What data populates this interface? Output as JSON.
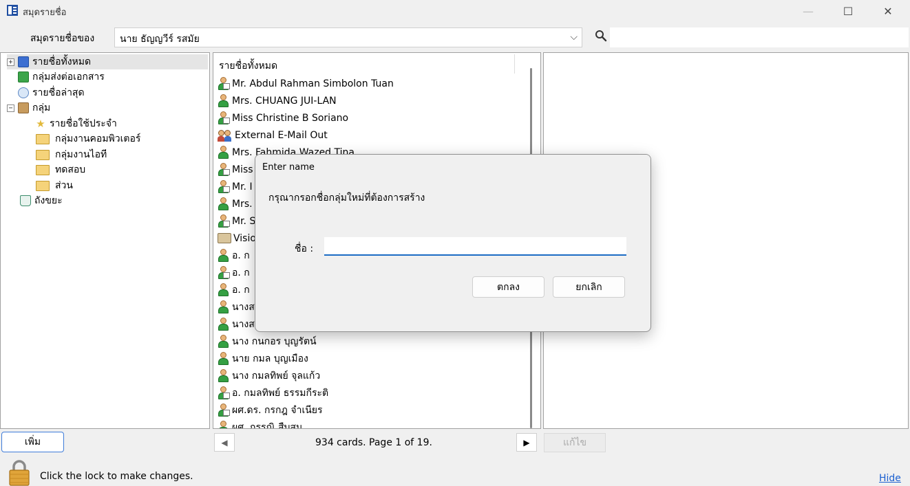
{
  "window": {
    "title": "สมุดรายชื่อ",
    "minimize_glyph": "—",
    "maximize_glyph": "☐",
    "close_glyph": "✕"
  },
  "toolbar": {
    "owner_label": "สมุดรายชื่อของ",
    "owner_value": "นาย ธัญญวีร์ รสมัย",
    "dropdown_glyph": "⌵",
    "search_placeholder": ""
  },
  "tree": [
    {
      "label": "รายชื่อทั้งหมด",
      "icon": "address-book-icon",
      "toggle": "+",
      "selected": true
    },
    {
      "label": "กลุ่มส่งต่อเอกสาร",
      "icon": "forward-group-icon"
    },
    {
      "label": "รายชื่อล่าสุด",
      "icon": "recent-icon"
    },
    {
      "label": "กลุ่ม",
      "icon": "groups-icon",
      "toggle": "−"
    },
    {
      "label": "รายชื่อใช้ประจำ",
      "icon": "favorites-icon",
      "child": true
    },
    {
      "label": "กลุ่มงานคอมพิวเตอร์",
      "icon": "folder-icon",
      "child": true
    },
    {
      "label": "กลุ่มงานไอที",
      "icon": "folder-icon",
      "child": true
    },
    {
      "label": "ทดสอบ",
      "icon": "folder-icon",
      "child": true
    },
    {
      "label": "ส่วน",
      "icon": "folder-icon",
      "child": true
    },
    {
      "label": "ถังขยะ",
      "icon": "trash-icon"
    }
  ],
  "list": {
    "header": "รายชื่อทั้งหมด",
    "rows": [
      {
        "name": "Mr. Abdul Rahman Simbolon Tuan",
        "icon": "contact-card-icon"
      },
      {
        "name": "Mrs. CHUANG JUI-LAN",
        "icon": "contact-icon"
      },
      {
        "name": "Miss Christine B Soriano",
        "icon": "contact-card-icon"
      },
      {
        "name": "External E-Mail Out",
        "icon": "group-icon"
      },
      {
        "name": "Mrs. Fahmida Wazed Tina",
        "icon": "contact-icon"
      },
      {
        "name": "Miss",
        "icon": "contact-card-icon"
      },
      {
        "name": "Mr. I",
        "icon": "contact-card-icon"
      },
      {
        "name": "Mrs.",
        "icon": "contact-icon"
      },
      {
        "name": "Mr. S",
        "icon": "contact-card-icon"
      },
      {
        "name": "Visio",
        "icon": "book-icon"
      },
      {
        "name": "อ. ก",
        "icon": "contact-icon"
      },
      {
        "name": "อ. ก",
        "icon": "contact-card-icon"
      },
      {
        "name": "อ. ก",
        "icon": "contact-icon"
      },
      {
        "name": "นางส",
        "icon": "contact-icon"
      },
      {
        "name": "นางส",
        "icon": "contact-icon"
      },
      {
        "name": "นาง กนกอร บุญรัตน์",
        "icon": "contact-icon"
      },
      {
        "name": "นาย กมล บุญเมือง",
        "icon": "contact-icon"
      },
      {
        "name": "นาง กมลทิพย์ จุลแก้ว",
        "icon": "contact-icon"
      },
      {
        "name": "อ. กมลทิพย์ ธรรมกีระติ",
        "icon": "contact-card-icon"
      },
      {
        "name": "ผศ.ดร. กรกฎ จำเนียร",
        "icon": "contact-card-icon"
      },
      {
        "name": "ผศ. กรรณิ สืบสม",
        "icon": "contact-icon"
      }
    ]
  },
  "bottom": {
    "add_label": "เพิ่ม",
    "prev_glyph": "◀",
    "next_glyph": "▶",
    "page_info": "934 cards. Page 1 of 19.",
    "edit_label": "แก้ไข",
    "lock_text": "Click the lock to make changes.",
    "hide_label": "Hide"
  },
  "dialog": {
    "title": "Enter name",
    "message": "กรุณากรอกชื่อกลุ่มใหม่ที่ต้องการสร้าง",
    "name_label": "ชื่อ :",
    "name_value": "",
    "ok_label": "ตกลง",
    "cancel_label": "ยกเลิก"
  },
  "colors": {
    "accent": "#1a6bc4",
    "link": "#1a5fd0",
    "background": "#f0f0f0"
  }
}
